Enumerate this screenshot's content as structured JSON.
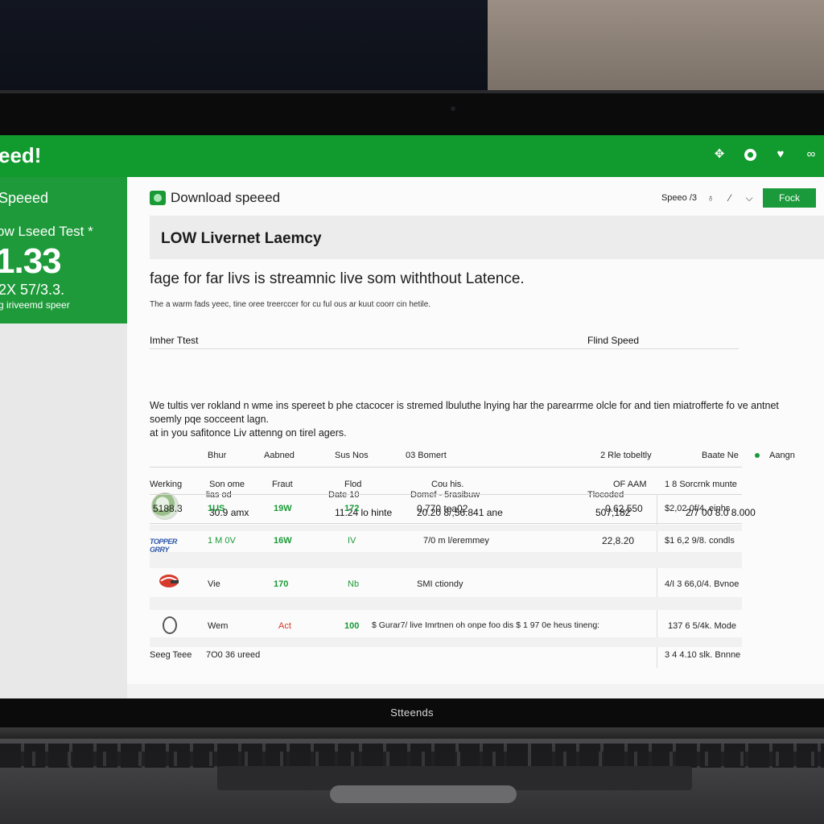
{
  "app": {
    "title": "eed!"
  },
  "topbar": {
    "icons": [
      "move-icon",
      "circle-icon",
      "heart-icon",
      "link-icon"
    ]
  },
  "sidebar": {
    "title": "Speeed",
    "subtitle": "ow Lseed Test *",
    "big_value": "1.33",
    "number": "2X 57/3.3.",
    "caption": "g iriveemd speer"
  },
  "header": {
    "download_label": "Download speeed",
    "speed_label": "Speeo /3",
    "back_label": "Fock"
  },
  "banner": {
    "text": "LOW Livernet Laemcy"
  },
  "headline": "fage for far livs is streamnic live som withthout Latence.",
  "small_note": "The a warm fads yeec, tine oree treerccer for cu ful ous ar kuut coorr cin hetile.",
  "summary": {
    "left_title": "Imher Ttest",
    "right_title": "Flind Speed",
    "columns": [
      "lias od",
      "Date 10",
      "Domef - 5rasibuw",
      "Tlocoded"
    ],
    "values": [
      "30.9 amx",
      "11.24 lo hinte",
      "20.20 8/,56.841 ane",
      "507,182",
      "2/7 00 8.0 8.000"
    ]
  },
  "paragraph": {
    "line1": "We tultis ver rokland n wme ins spereet b phe ctacocer is stremed lbuluthe lnying har the parearrme olcle for and tien miatrofferte fo ve antnet",
    "line2": "soemly pqe socceent lagn.",
    "line3": "at in you safitonce Liv attenng on tirel agers."
  },
  "table": {
    "group_headers": [
      "Bhur",
      "Aabned",
      "Sus Nos",
      "03 Bomert",
      "2  Rle tobeltly",
      "Baate Ne",
      "Aangn"
    ],
    "headers": [
      "Werking",
      "Son ome",
      "Fraut",
      "Flod",
      "Cou his.",
      "OF AAM",
      "1 8 Sorcrnk munte"
    ],
    "rows": [
      {
        "c1": "5188.3",
        "c2": "1US",
        "c3": "19W",
        "c4": "172",
        "c5": "0.770 tea02",
        "c6": "0.62,550",
        "c7": "$2,02 0f/4. einhs",
        "icon": ""
      },
      {
        "c1": "",
        "c2": "1 M 0V",
        "c3": "16W",
        "c4": "IV",
        "c5": "7/0 m l/eremmey",
        "c6": "22,8.20",
        "c7": "$1 6,2 9/8. condls",
        "icon": "team-logo-icon"
      },
      {
        "c1": "",
        "c2": "Vie",
        "c3": "170",
        "c4": "Nb",
        "c5": "SMI ctiondy",
        "c6": "",
        "c7": "4/I 3 66,0/4. Bvnoe",
        "icon": "helmet-icon"
      },
      {
        "c1": "",
        "c2": "Wem",
        "c3": "Act",
        "c4": "100",
        "c5": "$ Gurar7/ live Imrtnen oh onpe foo dis $ 1 97 0e heus tineng:",
        "c6": "",
        "c7": "137 6 5/4k. Mode",
        "icon": "seal-icon"
      },
      {
        "c1": "Seeg Teee",
        "c2": "7O0 36 ureed",
        "c3": "",
        "c4": "",
        "c5": "",
        "c6": "",
        "c7": "3 4 4.10 slk. Bnnne",
        "icon": ""
      }
    ],
    "logo_text": "TOPPER GRRY"
  },
  "laptop": {
    "brand": "Stteends"
  },
  "colors": {
    "accent": "#119a2e",
    "accent_dark": "#1a9a3a",
    "table_green": "#189a35",
    "table_red": "#d23a2a"
  }
}
